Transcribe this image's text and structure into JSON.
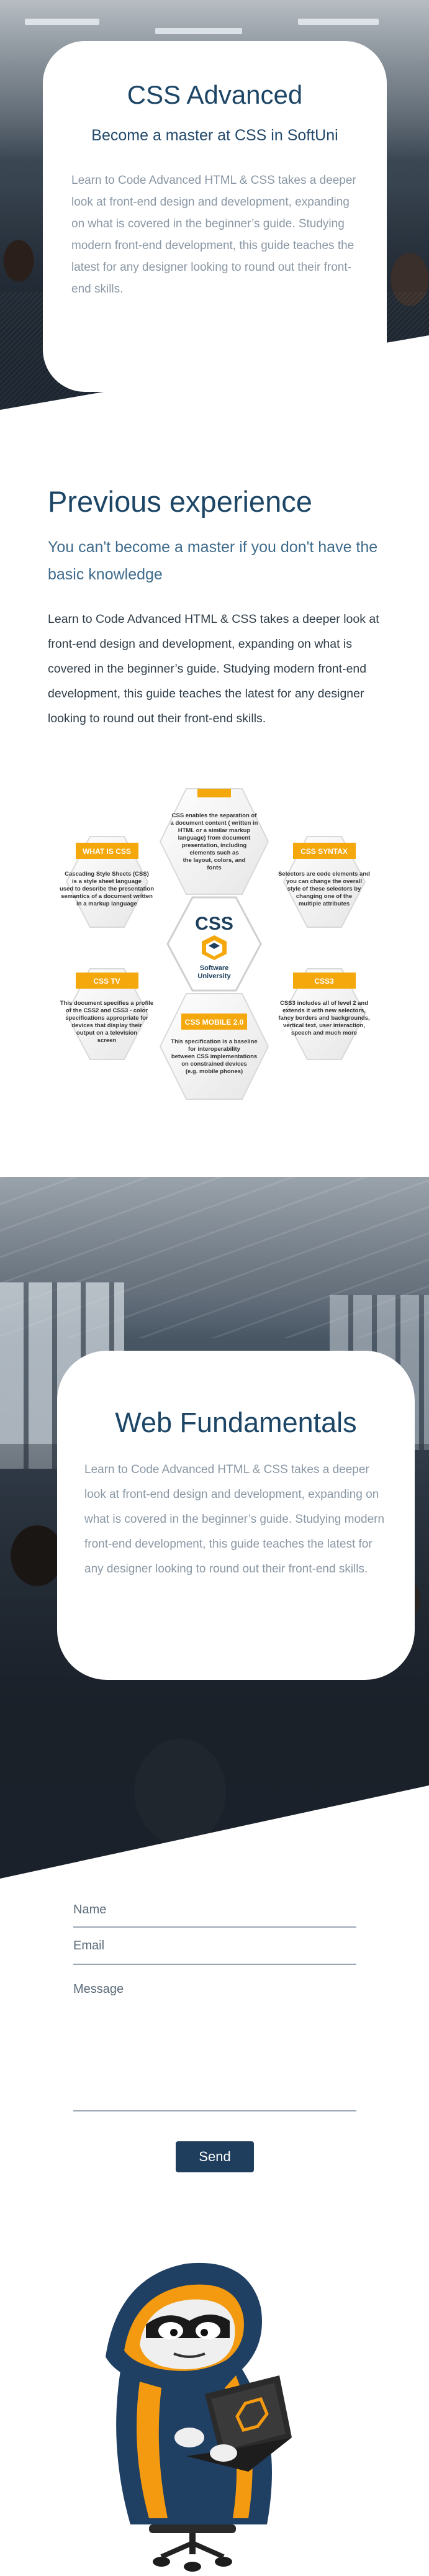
{
  "hero": {
    "title": "CSS Advanced",
    "subtitle": "Become a master at CSS in SoftUni",
    "text": "Learn to Code Advanced HTML & CSS takes a deeper look at front-end design and development, expanding on what is covered in the beginner’s guide. Studying modern front-end development, this guide teaches the latest for any designer looking to round out their front-end skills."
  },
  "previous": {
    "title": "Previous experience",
    "subtitle": "You can't become a master if you don't have the basic knowledge",
    "text": "Learn to Code Advanced HTML & CSS takes a deeper look at front-end design and development, expanding on what is covered in the beginner’s guide. Studying modern front-end development, this guide teaches the latest for any designer looking to round out their front-end skills."
  },
  "infographic": {
    "center_title": "CSS",
    "center_org_line1": "Software",
    "center_org_line2": "University",
    "accent_color": "#f5a80c",
    "hexes": [
      {
        "heading": "WHAT IS CSS",
        "text": [
          "Cascading Style Sheets (CSS)",
          "is a style sheet language",
          "used to describe the presentation",
          "semantics of a document written",
          "in a markup language"
        ]
      },
      {
        "heading": "",
        "text": [
          "CSS enables the separation of",
          "a document content ( written in",
          "HTML or a similar markup",
          "language) from document",
          "presentation, including",
          "elements such as",
          "the layout, colors, and",
          "fonts"
        ]
      },
      {
        "heading": "CSS SYNTAX",
        "text": [
          "Selectors are code elements and",
          "you can change the overall",
          "style of these selectors by",
          "changing one of the",
          "multiple attributes"
        ]
      },
      {
        "heading": "CSS TV",
        "text": [
          "This document specifies a profile",
          "of the CSS2 and CSS3 - color",
          "specifications appropriate for",
          "devices that display their",
          "output on a television",
          "screen"
        ]
      },
      {
        "heading": "CSS MOBILE 2.0",
        "text": [
          "This specification is a baseline",
          "for interoperability",
          "between CSS implementations",
          "on constrained devices",
          "(e.g. mobile phones)"
        ]
      },
      {
        "heading": "CSS3",
        "text": [
          "CSS3 includes all of level 2 and",
          "extends it with new selectors,",
          "fancy borders and backgrounds,",
          "vertical text, user interaction,",
          "speech and much more"
        ]
      }
    ]
  },
  "fundamentals": {
    "title": "Web Fundamentals",
    "text": "Learn to Code Advanced HTML & CSS takes a deeper look at front-end design and development, expanding on what is covered in the beginner’s guide. Studying modern front-end development, this guide teaches the latest for any designer looking to round out their front-end skills."
  },
  "form": {
    "name_placeholder": "Name",
    "email_placeholder": "Email",
    "message_placeholder": "Message",
    "send_label": "Send"
  }
}
